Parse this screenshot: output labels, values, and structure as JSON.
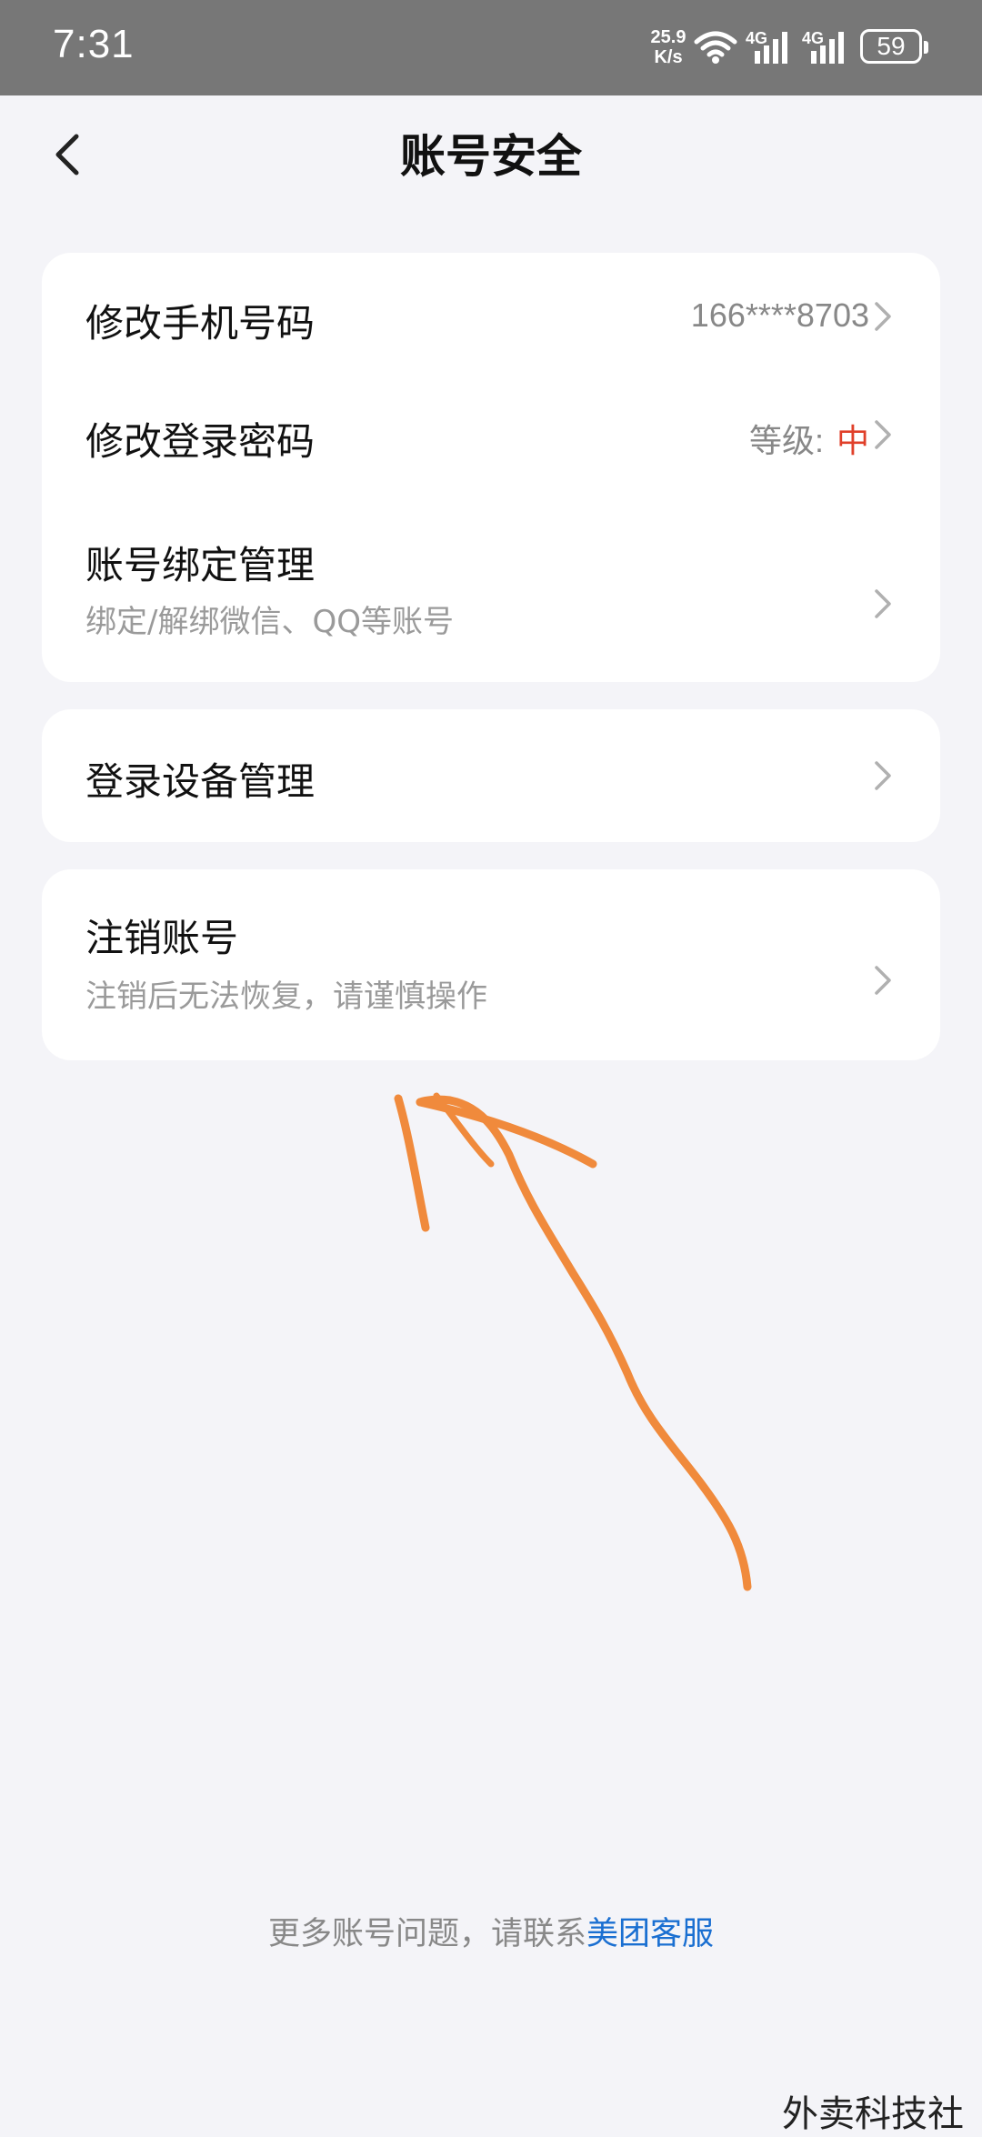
{
  "status_bar": {
    "time": "7:31",
    "net_speed_value": "25.9",
    "net_speed_unit": "K/s",
    "network_1": "4G",
    "network_2": "4G",
    "battery": "59"
  },
  "header": {
    "title": "账号安全"
  },
  "card1": {
    "items": [
      {
        "title": "修改手机号码",
        "value": "166****8703"
      },
      {
        "title": "修改登录密码",
        "value_label": "等级:",
        "value_level": "中"
      },
      {
        "title": "账号绑定管理",
        "subtitle": "绑定/解绑微信、QQ等账号"
      }
    ]
  },
  "card2": {
    "items": [
      {
        "title": "登录设备管理"
      }
    ]
  },
  "card3": {
    "items": [
      {
        "title": "注销账号",
        "subtitle": "注销后无法恢复，请谨慎操作"
      }
    ]
  },
  "footer": {
    "text": "更多账号问题，请联系",
    "link": "美团客服"
  },
  "watermark": "外卖科技社",
  "colors": {
    "status_bar_bg": "#777777",
    "page_bg": "#f4f4f8",
    "level_red": "#e0402a",
    "link_blue": "#1a6fd1",
    "annotation_orange": "#f08a3c"
  }
}
